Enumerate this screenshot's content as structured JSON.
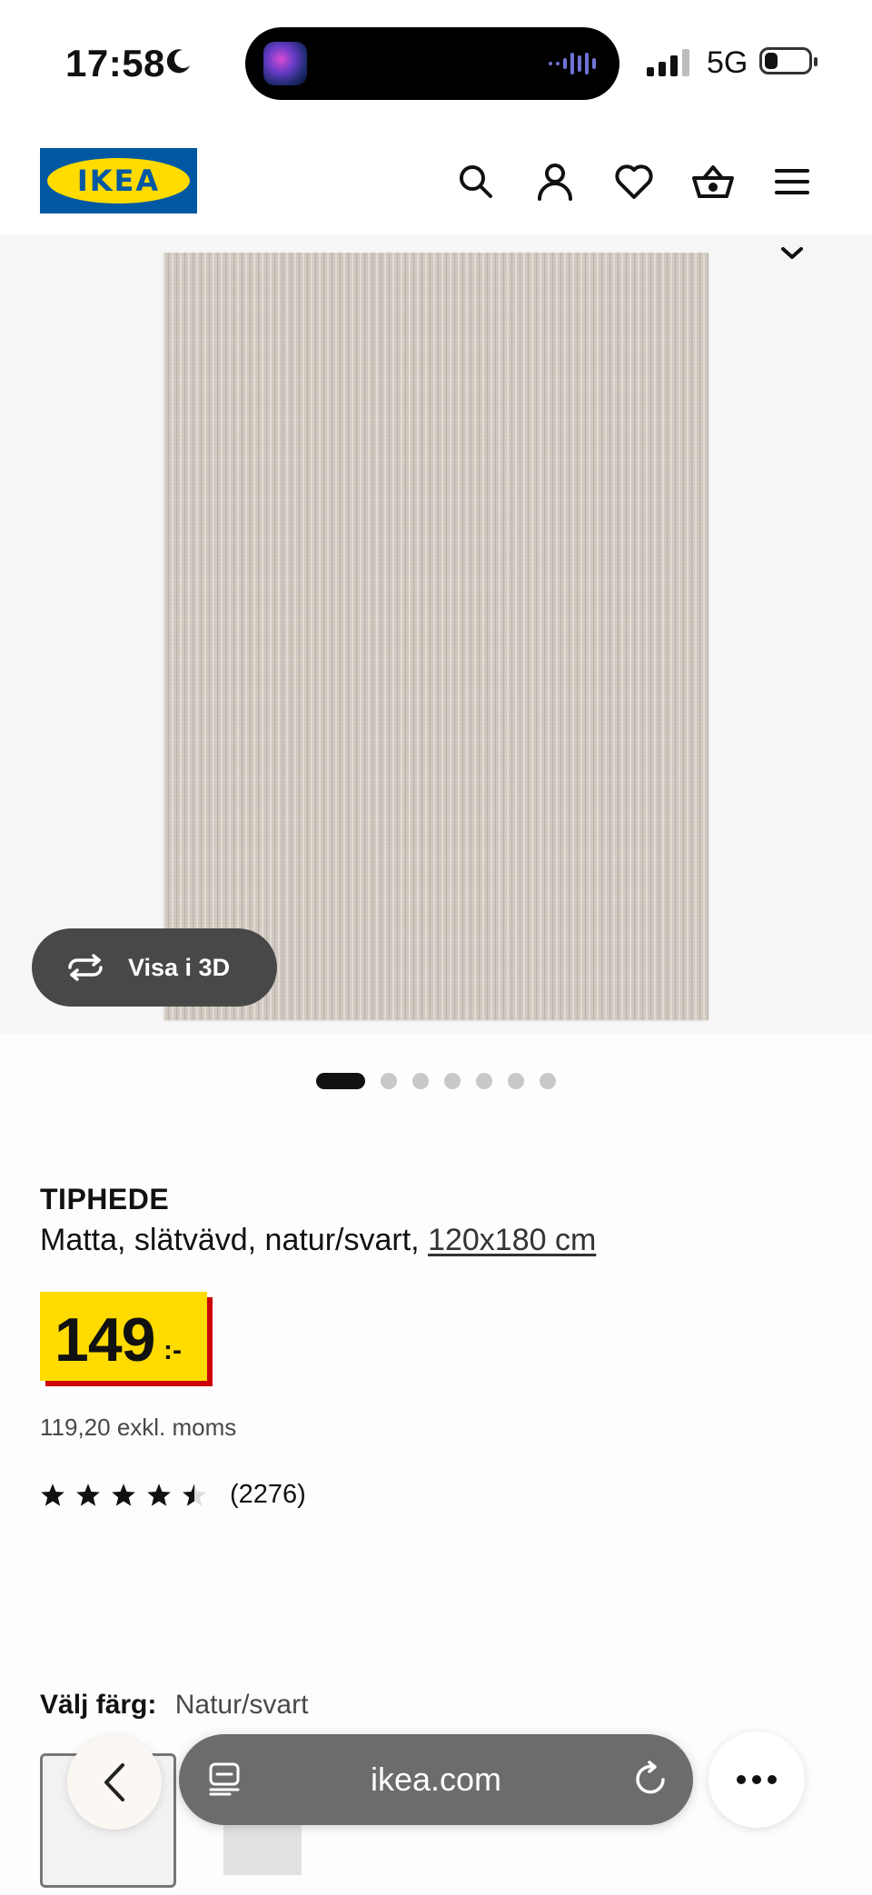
{
  "status_bar": {
    "time": "17:58",
    "network": "5G"
  },
  "header": {
    "logo_text": "IKEA"
  },
  "gallery": {
    "view_3d_label": "Visa i 3D",
    "image_count": 7,
    "active_index": 0
  },
  "product": {
    "name": "TIPHEDE",
    "description": "Matta, slätvävd, natur/svart,",
    "size": "120x180 cm",
    "price": "149",
    "price_suffix": ":-",
    "price_excl_vat": "119,20 exkl. moms",
    "rating": 4.5,
    "review_count": "(2276)"
  },
  "color_picker": {
    "label": "Välj färg:",
    "value": "Natur/svart"
  },
  "browser": {
    "url": "ikea.com"
  },
  "colors": {
    "ikea_blue": "#0058a3",
    "ikea_yellow": "#ffdb00",
    "price_red": "#cc0008"
  }
}
